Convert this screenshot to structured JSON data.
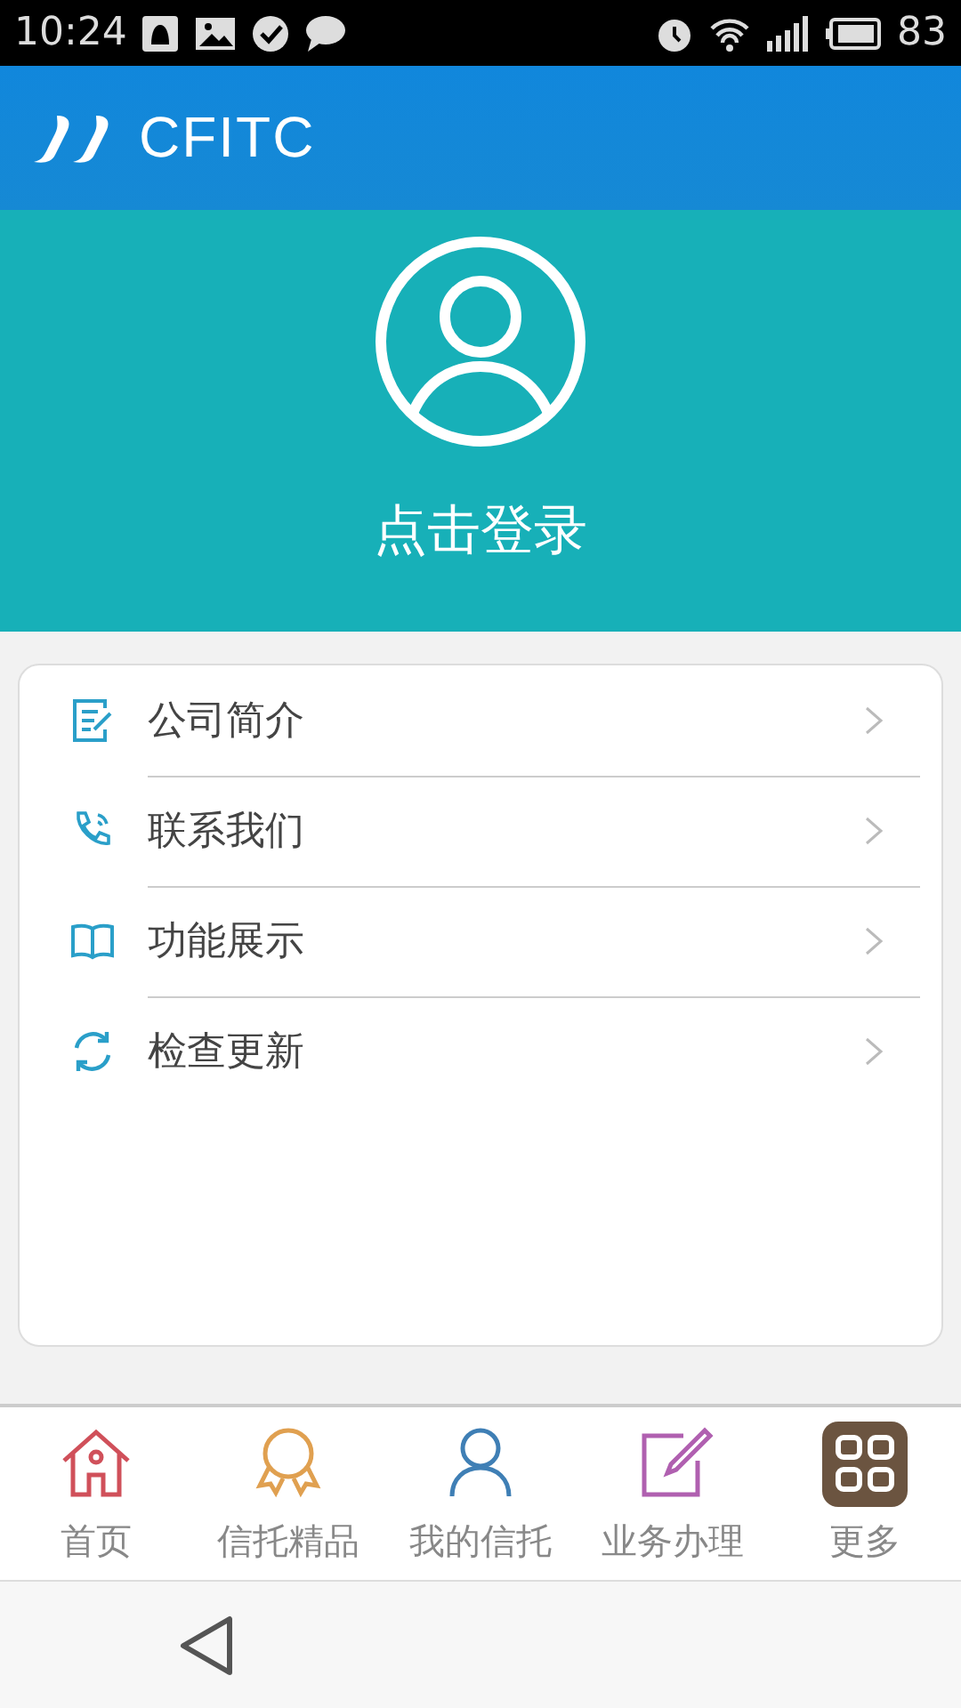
{
  "status_bar": {
    "time": "10:24",
    "battery": "83"
  },
  "header": {
    "logo": "CFITC"
  },
  "profile": {
    "login": "点击登录"
  },
  "menu": [
    {
      "label": "公司简介",
      "kind": "document"
    },
    {
      "label": "联系我们",
      "kind": "phone"
    },
    {
      "label": "功能展示",
      "kind": "book"
    },
    {
      "label": "检查更新",
      "kind": "refresh"
    }
  ],
  "tabs": [
    {
      "label": "首页",
      "kind": "home",
      "color": "#d0505a",
      "selected": false
    },
    {
      "label": "信托精品",
      "kind": "medal",
      "color": "#e0a050",
      "selected": false
    },
    {
      "label": "我的信托",
      "kind": "person",
      "color": "#3f7fb5",
      "selected": false
    },
    {
      "label": "业务办理",
      "kind": "edit",
      "color": "#b060b0",
      "selected": false
    },
    {
      "label": "更多",
      "kind": "grid",
      "color": "#6b5440",
      "selected": true
    }
  ]
}
